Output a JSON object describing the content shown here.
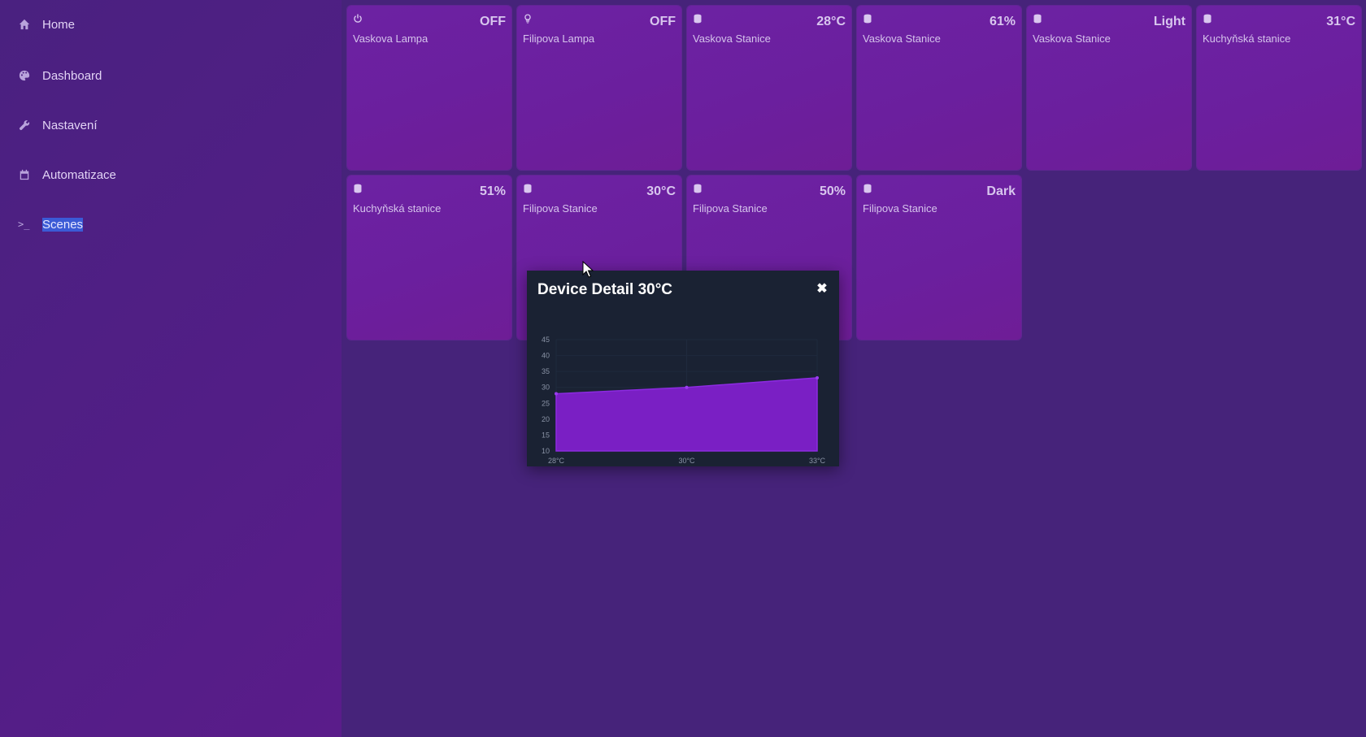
{
  "sidebar": {
    "items": [
      {
        "label": "Home",
        "icon": "home-icon"
      },
      {
        "label": "Dashboard",
        "icon": "palette-icon"
      },
      {
        "label": "Nastavení",
        "icon": "wrench-icon"
      },
      {
        "label": "Automatizace",
        "icon": "calendar-icon"
      },
      {
        "label": "Scenes",
        "icon": "terminal-icon",
        "glyph": ">_"
      }
    ]
  },
  "tiles": [
    {
      "name": "Vaskova Lampa",
      "value": "OFF",
      "icon": "power-icon"
    },
    {
      "name": "Filipova Lampa",
      "value": "OFF",
      "icon": "lightbulb-icon"
    },
    {
      "name": "Vaskova Stanice",
      "value": "28°C",
      "icon": "cylinder-icon"
    },
    {
      "name": "Vaskova Stanice",
      "value": "61%",
      "icon": "cylinder-icon"
    },
    {
      "name": "Vaskova Stanice",
      "value": "Light",
      "icon": "cylinder-icon"
    },
    {
      "name": "Kuchyňská stanice",
      "value": "31°C",
      "icon": "cylinder-icon"
    },
    {
      "name": "Kuchyňská stanice",
      "value": "51%",
      "icon": "cylinder-icon"
    },
    {
      "name": "Filipova Stanice",
      "value": "30°C",
      "icon": "cylinder-icon"
    },
    {
      "name": "Filipova Stanice",
      "value": "50%",
      "icon": "cylinder-icon"
    },
    {
      "name": "Filipova Stanice",
      "value": "Dark",
      "icon": "cylinder-icon"
    }
  ],
  "modal": {
    "title": "Device Detail 30°C",
    "close_glyph": "✖"
  },
  "colors": {
    "background": "#46237a",
    "tile": "#6b1f9e",
    "modal_bg": "#1a2233",
    "chart_fill": "#7a1fc4",
    "selection": "#3b5bd6"
  },
  "chart_data": {
    "type": "area",
    "categories": [
      "28°C",
      "30°C",
      "33°C"
    ],
    "values": [
      28,
      30,
      33
    ],
    "ylim": [
      10,
      45
    ],
    "yticks": [
      10,
      15,
      20,
      25,
      30,
      35,
      40,
      45
    ],
    "grid": true
  }
}
